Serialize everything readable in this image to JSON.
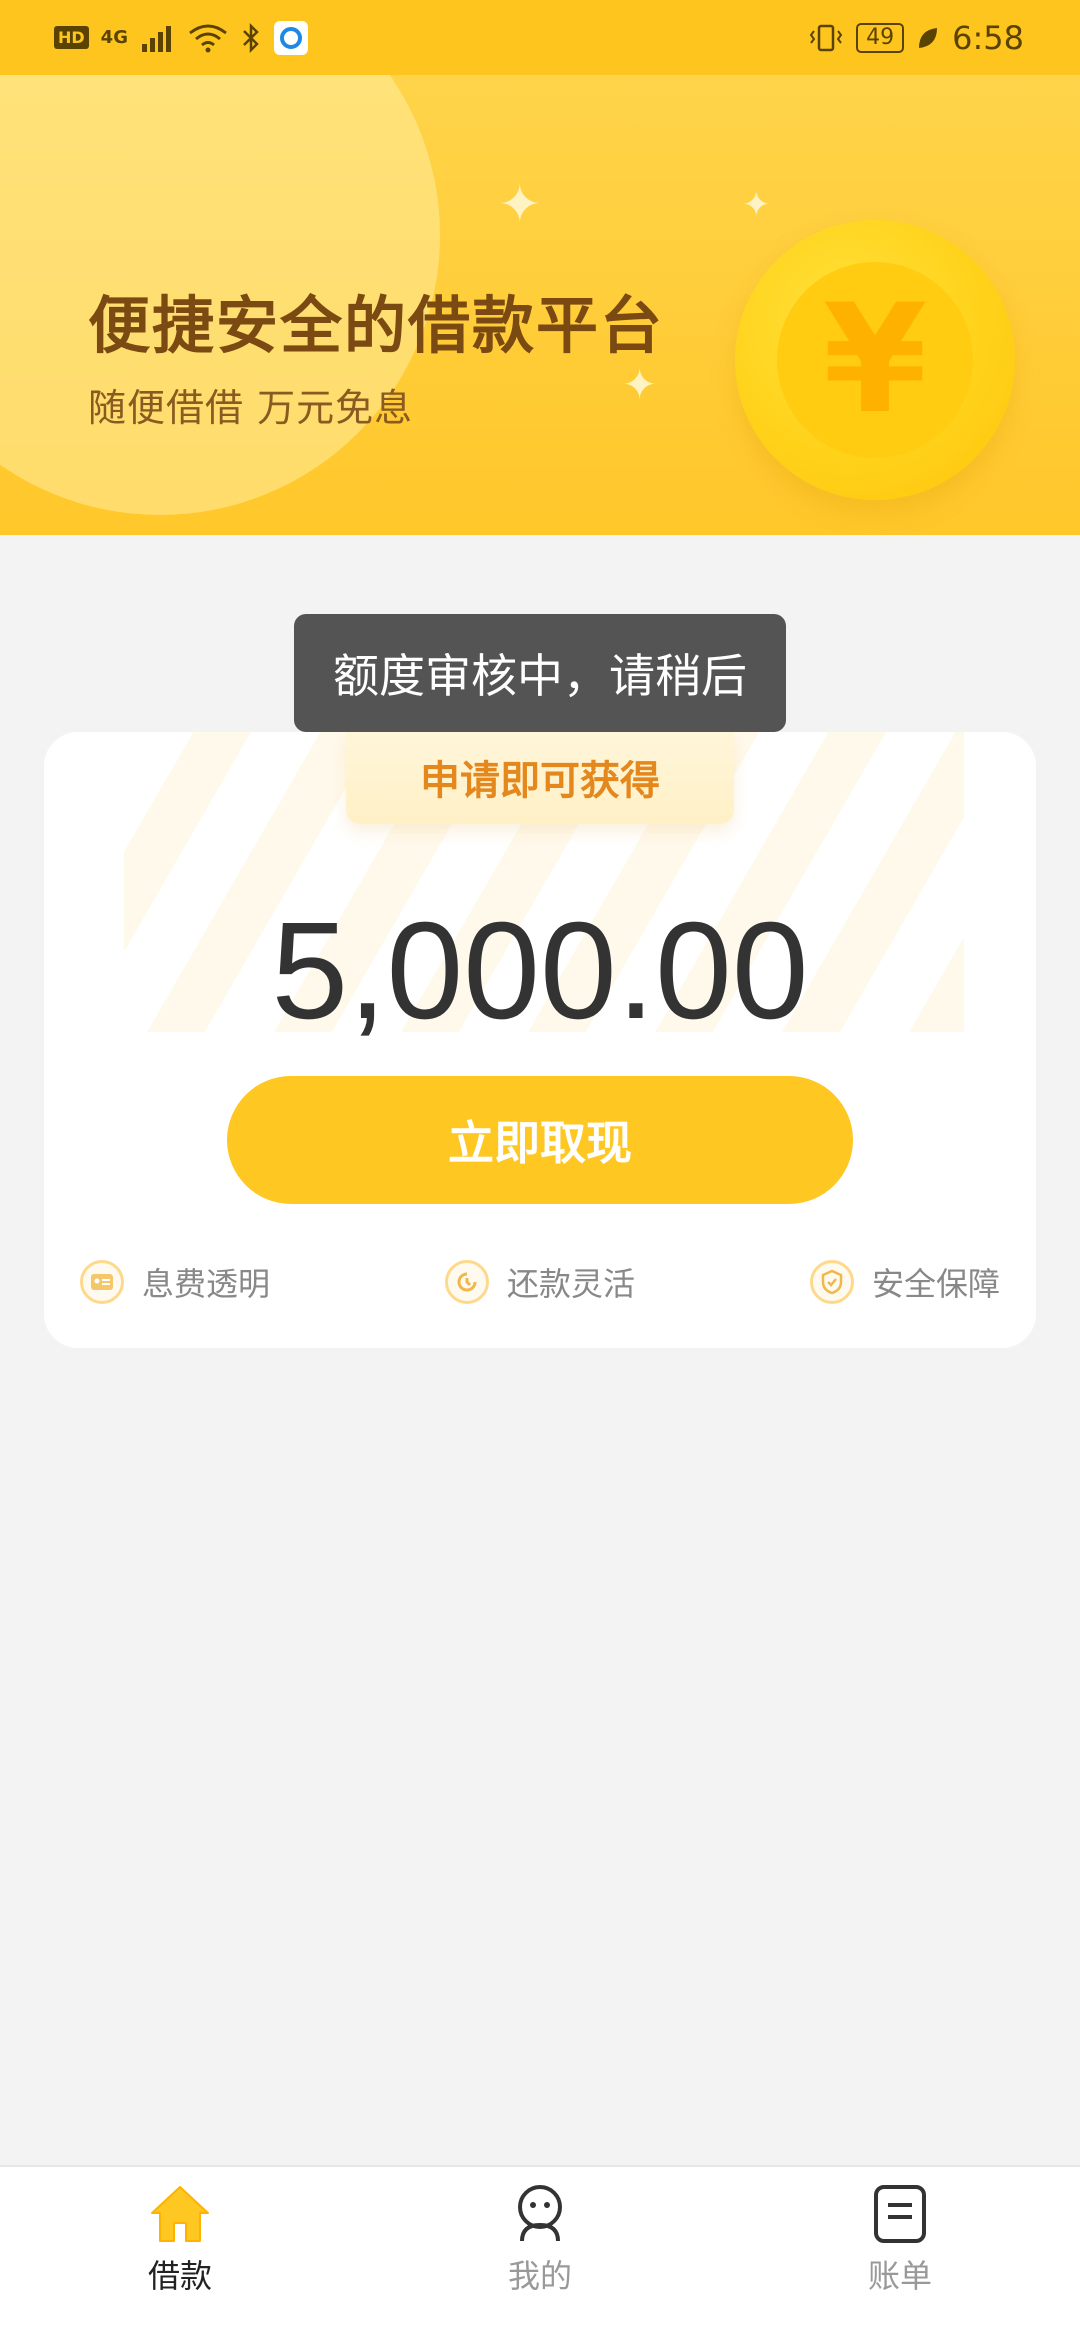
{
  "status_bar": {
    "hd": "HD",
    "network": "4G",
    "battery": "49",
    "time": "6:58"
  },
  "banner": {
    "title": "便捷安全的借款平台",
    "subtitle": "随便借借 万元免息",
    "coin_symbol": "¥"
  },
  "toast": {
    "message": "额度审核中，请稍后"
  },
  "card": {
    "ribbon": "申请即可获得",
    "amount": "5,000.00",
    "cta_label": "立即取现",
    "features": [
      {
        "label": "息费透明",
        "icon": "id-card-icon"
      },
      {
        "label": "还款灵活",
        "icon": "refresh-icon"
      },
      {
        "label": "安全保障",
        "icon": "shield-check-icon"
      }
    ]
  },
  "bottom_nav": {
    "items": [
      {
        "label": "借款",
        "icon": "home-icon",
        "active": true
      },
      {
        "label": "我的",
        "icon": "profile-icon",
        "active": false
      },
      {
        "label": "账单",
        "icon": "bill-icon",
        "active": false
      }
    ]
  },
  "colors": {
    "accent": "#ffc722",
    "banner_title": "#7b4a12",
    "ribbon_text": "#e4871c"
  }
}
